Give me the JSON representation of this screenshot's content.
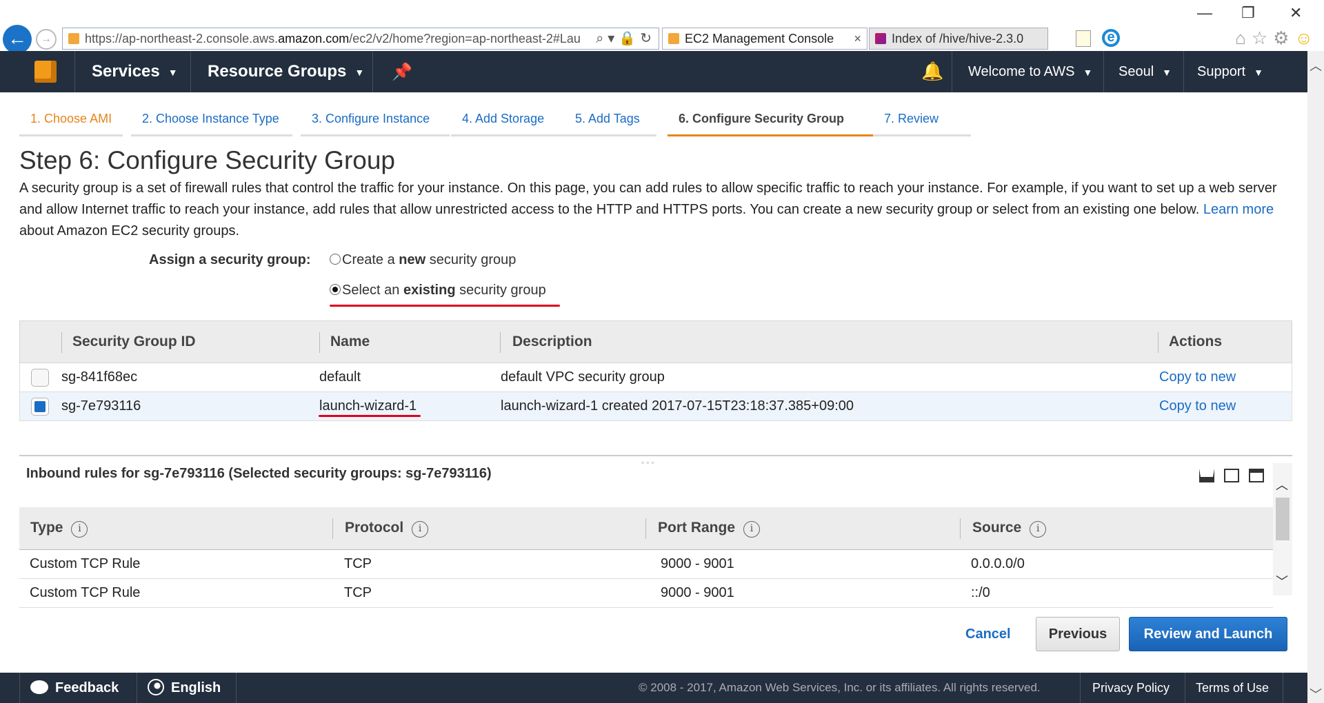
{
  "browser": {
    "url_prefix": "https://ap-northeast-2.console.aws.",
    "url_domain": "amazon.com",
    "url_suffix": "/ec2/v2/home?region=ap-northeast-2#Lau",
    "tabs": [
      {
        "label": "EC2 Management Console",
        "active": true
      },
      {
        "label": "Index of /hive/hive-2.3.0",
        "active": false
      }
    ],
    "tab_close": "×",
    "win_minimize": "—",
    "win_restore": "❐",
    "win_close": "✕"
  },
  "aws_header": {
    "services": "Services",
    "resource_groups": "Resource Groups",
    "account": "Welcome to AWS",
    "region": "Seoul",
    "support": "Support"
  },
  "wizard": {
    "steps": [
      {
        "label": "1. Choose AMI",
        "state": "done"
      },
      {
        "label": "2. Choose Instance Type",
        "state": "link"
      },
      {
        "label": "3. Configure Instance",
        "state": "link"
      },
      {
        "label": "4. Add Storage",
        "state": "link"
      },
      {
        "label": "5. Add Tags",
        "state": "link"
      },
      {
        "label": "6. Configure Security Group",
        "state": "current"
      },
      {
        "label": "7. Review",
        "state": "link"
      }
    ]
  },
  "page": {
    "title": "Step 6: Configure Security Group",
    "desc_1": "A security group is a set of firewall rules that control the traffic for your instance. On this page, you can add rules to allow specific traffic to reach your instance. For example, if you want to set up a web server and allow Internet traffic to reach your instance, add rules that allow unrestricted access to the HTTP and HTTPS ports. You can create a new security group or select from an existing one below.",
    "learn_more": "Learn more",
    "desc_2": "about Amazon EC2 security groups."
  },
  "assign": {
    "label": "Assign a security group:",
    "opt_new_pre": "Create a ",
    "opt_new_bold": "new",
    "opt_new_post": " security group",
    "opt_existing_pre": "Select an ",
    "opt_existing_bold": "existing",
    "opt_existing_post": " security group",
    "selected": "existing"
  },
  "sg_table": {
    "headers": {
      "id": "Security Group ID",
      "name": "Name",
      "description": "Description",
      "actions": "Actions"
    },
    "rows": [
      {
        "id": "sg-841f68ec",
        "name": "default",
        "description": "default VPC security group",
        "action": "Copy to new",
        "checked": false
      },
      {
        "id": "sg-7e793116",
        "name": "launch-wizard-1",
        "description": "launch-wizard-1 created 2017-07-15T23:18:37.385+09:00",
        "action": "Copy to new",
        "checked": true
      }
    ]
  },
  "inbound": {
    "title": "Inbound rules for sg-7e793116 (Selected security groups: sg-7e793116)",
    "headers": {
      "type": "Type",
      "protocol": "Protocol",
      "port_range": "Port Range",
      "source": "Source"
    },
    "info_glyph": "i",
    "rows": [
      {
        "type": "Custom TCP Rule",
        "protocol": "TCP",
        "port_range": "9000 - 9001",
        "source": "0.0.0.0/0"
      },
      {
        "type": "Custom TCP Rule",
        "protocol": "TCP",
        "port_range": "9000 - 9001",
        "source": "::/0"
      }
    ]
  },
  "actions": {
    "cancel": "Cancel",
    "previous": "Previous",
    "review_launch": "Review and Launch"
  },
  "footer": {
    "feedback": "Feedback",
    "language": "English",
    "copyright": "© 2008 - 2017, Amazon Web Services, Inc. or its affiliates. All rights reserved.",
    "privacy": "Privacy Policy",
    "terms": "Terms of Use"
  },
  "colors": {
    "aws_nav": "#232f3e",
    "link_blue": "#1a6cc4",
    "step_orange": "#e8841a",
    "highlight_red": "#e0001b",
    "primary_button": "#1a62b6"
  },
  "icons": [
    "back-arrow-icon",
    "forward-arrow-icon",
    "search-icon",
    "lock-icon",
    "refresh-icon",
    "aws-cube-icon",
    "pin-icon",
    "bell-icon",
    "info-icon",
    "feedback-bubble-icon",
    "globe-icon",
    "home-icon",
    "star-icon",
    "gear-icon",
    "smiley-icon"
  ]
}
